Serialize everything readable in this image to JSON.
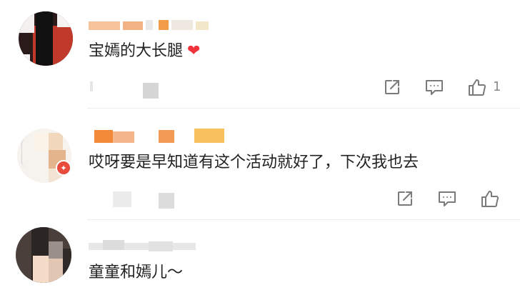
{
  "comments": [
    {
      "text": "宝嫣的大长腿",
      "heart_icon": "heart-icon",
      "actions": {
        "share_icon": "share-icon",
        "comment_icon": "comment-icon",
        "like_icon": "thumbs-up-icon",
        "like_count": "1"
      }
    },
    {
      "text": "哎呀要是早知道有这个活动就好了，下次我也去",
      "avatar_badge": "✦",
      "actions": {
        "share_icon": "share-icon",
        "comment_icon": "comment-icon",
        "like_icon": "thumbs-up-icon",
        "like_count": ""
      }
    },
    {
      "text": "童童和嫣儿～"
    }
  ],
  "colors": {
    "heart": "#f0333c",
    "icon_gray": "#7a7a7a",
    "badge": "#e84b3c",
    "mosaic_orange": "#f5a24a"
  }
}
